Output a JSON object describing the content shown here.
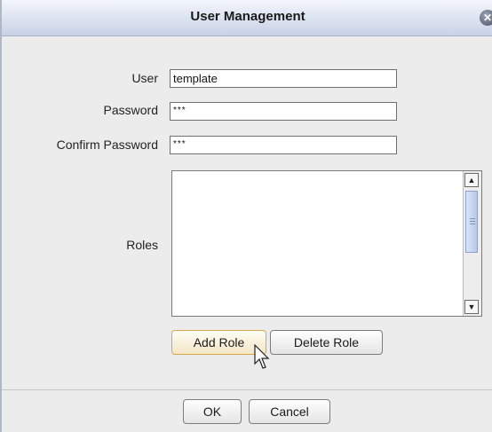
{
  "dialog": {
    "title": "User Management",
    "close_glyph": "✕"
  },
  "form": {
    "user_label": "User",
    "user_value": "template",
    "password_label": "Password",
    "password_value": "***",
    "confirm_label": "Confirm Password",
    "confirm_value": "***",
    "roles_label": "Roles",
    "roles_items": []
  },
  "roles_actions": {
    "add_label": "Add Role",
    "delete_label": "Delete Role"
  },
  "footer": {
    "ok_label": "OK",
    "cancel_label": "Cancel"
  },
  "icons": {
    "close": "close-icon",
    "cursor": "mouse-pointer-icon",
    "scroll_up": "scroll-up-arrow-icon",
    "scroll_down": "scroll-down-arrow-icon"
  }
}
